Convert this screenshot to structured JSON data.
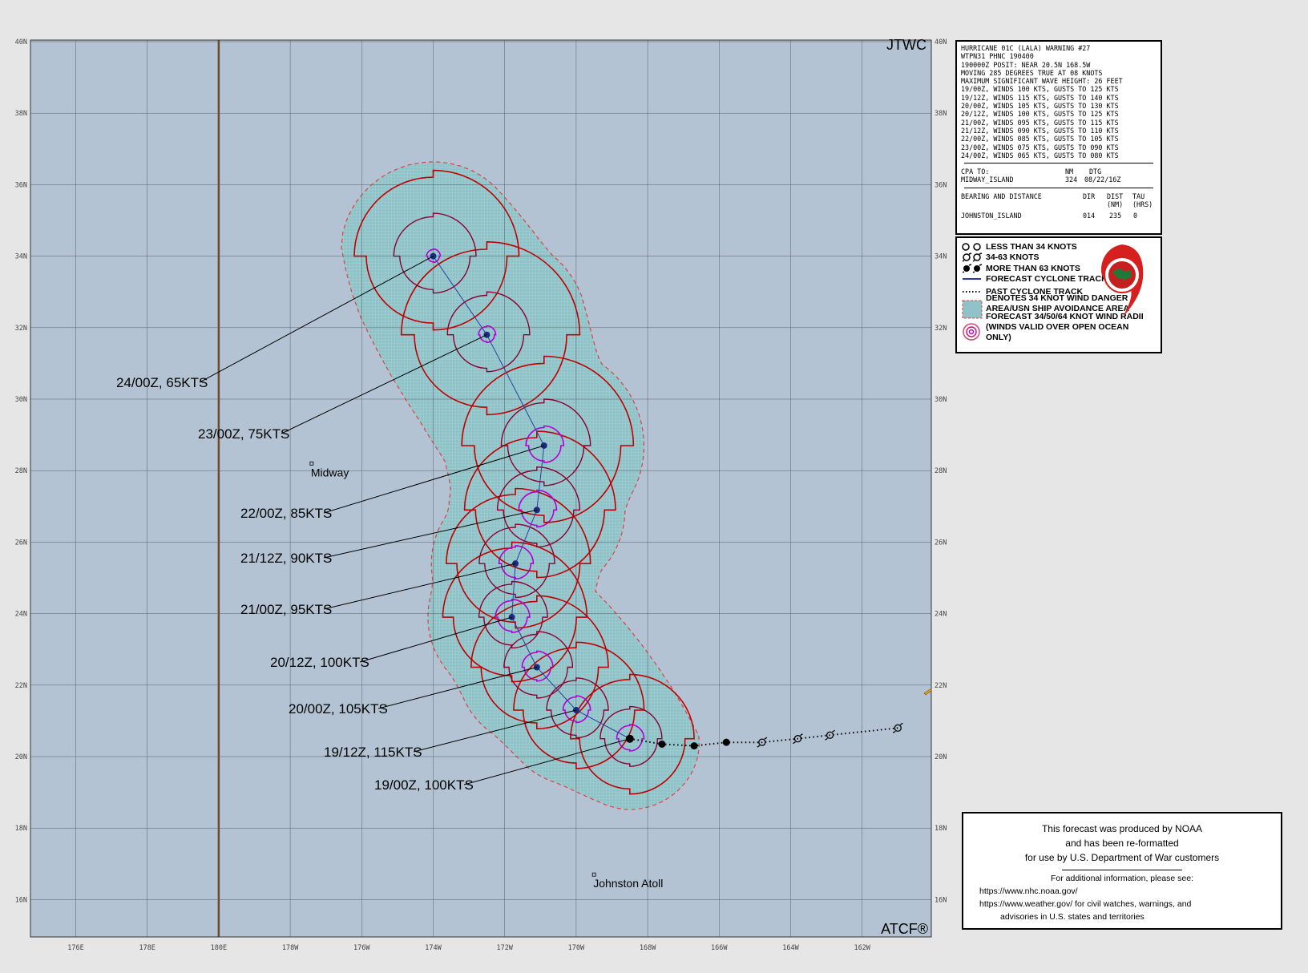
{
  "map": {
    "agency": "JTWC",
    "footer_mark": "ATCF®",
    "lon_labels": [
      "176E",
      "178E",
      "180E",
      "178W",
      "176W",
      "174W",
      "172W",
      "170W",
      "168W",
      "166W",
      "164W",
      "162W"
    ],
    "lat_labels": [
      "40N",
      "38N",
      "36N",
      "34N",
      "32N",
      "30N",
      "28N",
      "26N",
      "24N",
      "22N",
      "20N",
      "18N",
      "16N"
    ],
    "places": [
      {
        "name": "Midway",
        "lon": -177.4,
        "lat": 28.2
      },
      {
        "name": "Johnston Atoll",
        "lon": -169.5,
        "lat": 16.7
      }
    ],
    "colors": {
      "ocean": "#b3c3d3",
      "danger_area": "#8fc3c8",
      "danger_border": "#e04040",
      "r34": "#bf0000",
      "r50": "#8b0030",
      "r64": "#b400d4",
      "track": "#2a3d9c",
      "dateline": "#6b4a2b",
      "grid": "#5a5f66"
    }
  },
  "warning": {
    "lines": [
      "HURRICANE 01C (LALA) WARNING #27",
      "WTPN31 PHNC 190400",
      "190000Z POSIT: NEAR 20.5N 168.5W",
      "MOVING 285 DEGREES TRUE AT 08 KNOTS",
      "MAXIMUM SIGNIFICANT WAVE HEIGHT: 26 FEET",
      "19/00Z, WINDS 100 KTS, GUSTS TO 125 KTS",
      "19/12Z, WINDS 115 KTS, GUSTS TO 140 KTS",
      "20/00Z, WINDS 105 KTS, GUSTS TO 130 KTS",
      "20/12Z, WINDS 100 KTS, GUSTS TO 125 KTS",
      "21/00Z, WINDS 095 KTS, GUSTS TO 115 KTS",
      "21/12Z, WINDS 090 KTS, GUSTS TO 110 KTS",
      "22/00Z, WINDS 085 KTS, GUSTS TO 105 KTS",
      "23/00Z, WINDS 075 KTS, GUSTS TO 090 KTS",
      "24/00Z, WINDS 065 KTS, GUSTS TO 080 KTS"
    ],
    "cpa_label": "CPA TO:",
    "cpa_nm_header": "NM",
    "cpa_dtg_header": "DTG",
    "cpa_place": "MIDWAY_ISLAND",
    "cpa_nm": "324",
    "cpa_dtg": "08/22/16Z",
    "bearing_label": "BEARING AND DISTANCE",
    "dir_header": "DIR",
    "dist_header": "DIST",
    "tau_header": "TAU",
    "dist_unit": "(NM)",
    "tau_unit": "(HRS)",
    "bd_place": "JOHNSTON_ISLAND",
    "bd_dir": "014",
    "bd_dist": "235",
    "bd_tau": "0"
  },
  "legend": {
    "items": [
      "LESS THAN 34 KNOTS",
      "34-63 KNOTS",
      "MORE THAN 63 KNOTS",
      "FORECAST CYCLONE TRACK",
      "PAST CYCLONE TRACK",
      "DENOTES 34 KNOT WIND DANGER",
      "AREA/USN SHIP AVOIDANCE AREA",
      "FORECAST 34/50/64 KNOT WIND RADII",
      "(WINDS VALID OVER OPEN OCEAN ONLY)"
    ]
  },
  "noaa": {
    "line1": "This forecast was produced by NOAA",
    "line2": "and has been re-formatted",
    "line3": "for use by U.S. Department of War customers",
    "info": "For additional information, please see:",
    "link1": "https://www.nhc.noaa.gov/",
    "link2": "https://www.weather.gov/ for civil watches, warnings, and",
    "link3": "advisories in U.S. states and territories"
  },
  "track": {
    "forecast": [
      {
        "label": "19/00Z, 100KTS",
        "lon": -168.5,
        "lat": 20.5,
        "r34": 1.8,
        "r50": 0.9,
        "r64": 0.4
      },
      {
        "label": "19/12Z, 115KTS",
        "lon": -170.0,
        "lat": 21.3,
        "r34": 1.9,
        "r50": 0.9,
        "r64": 0.4
      },
      {
        "label": "20/00Z, 105KTS",
        "lon": -171.1,
        "lat": 22.5,
        "r34": 2.0,
        "r50": 1.0,
        "r64": 0.45
      },
      {
        "label": "20/12Z, 100KTS",
        "lon": -171.8,
        "lat": 23.9,
        "r34": 2.1,
        "r50": 1.0,
        "r64": 0.5
      },
      {
        "label": "21/00Z, 95KTS",
        "lon": -171.7,
        "lat": 25.4,
        "r34": 2.1,
        "r50": 1.1,
        "r64": 0.5
      },
      {
        "label": "21/12Z, 90KTS",
        "lon": -171.1,
        "lat": 26.9,
        "r34": 2.2,
        "r50": 1.2,
        "r64": 0.55
      },
      {
        "label": "22/00Z, 85KTS",
        "lon": -170.9,
        "lat": 28.7,
        "r34": 2.5,
        "r50": 1.3,
        "r64": 0.55
      },
      {
        "label": "23/00Z, 75KTS",
        "lon": -172.5,
        "lat": 31.8,
        "r34": 2.6,
        "r50": 1.2,
        "r64": 0.25
      },
      {
        "label": "24/00Z, 65KTS",
        "lon": -174.0,
        "lat": 34.0,
        "r34": 2.4,
        "r50": 1.2,
        "r64": 0.2
      }
    ],
    "past": [
      {
        "lon": -161.0,
        "lat": 20.8,
        "cat": "weak"
      },
      {
        "lon": -162.9,
        "lat": 20.6,
        "cat": "weak"
      },
      {
        "lon": -163.8,
        "lat": 20.5,
        "cat": "weak"
      },
      {
        "lon": -164.8,
        "lat": 20.4,
        "cat": "weak"
      },
      {
        "lon": -165.8,
        "lat": 20.4,
        "cat": "strong"
      },
      {
        "lon": -166.7,
        "lat": 20.3,
        "cat": "strong"
      },
      {
        "lon": -167.6,
        "lat": 20.35,
        "cat": "strong"
      }
    ]
  }
}
